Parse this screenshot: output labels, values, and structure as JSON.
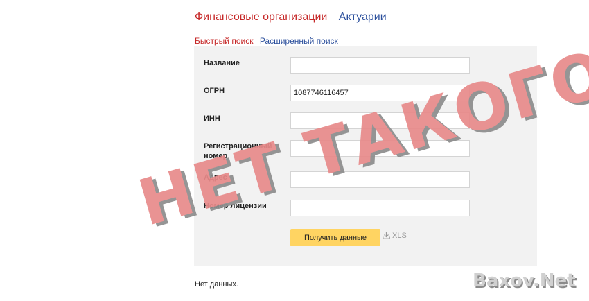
{
  "tabs": [
    {
      "label": "Финансовые организации",
      "active": true
    },
    {
      "label": "Актуарии",
      "active": false
    }
  ],
  "subtabs": [
    {
      "label": "Быстрый поиск",
      "active": true
    },
    {
      "label": "Расширенный поиск",
      "active": false
    }
  ],
  "form": {
    "fields": [
      {
        "label": "Название",
        "value": ""
      },
      {
        "label": "ОГРН",
        "value": "1087746116457"
      },
      {
        "label": "ИНН",
        "value": ""
      },
      {
        "label": "Регистрационный номер",
        "value": ""
      },
      {
        "label": "Адрес",
        "value": ""
      },
      {
        "label": "Номер лицензии",
        "value": ""
      }
    ],
    "submit_label": "Получить данные",
    "export_label": "XLS"
  },
  "results": {
    "empty_text": "Нет данных."
  },
  "stamp": {
    "text": "НЕТ ТАКОГО"
  },
  "watermark": {
    "text": "Baxov.Net"
  },
  "colors": {
    "active_tab": "#c62828",
    "inactive_tab": "#2b4f9c",
    "panel_bg": "#f2f2f2",
    "button_bg": "#ffd462",
    "stamp": "#e88a8a"
  }
}
